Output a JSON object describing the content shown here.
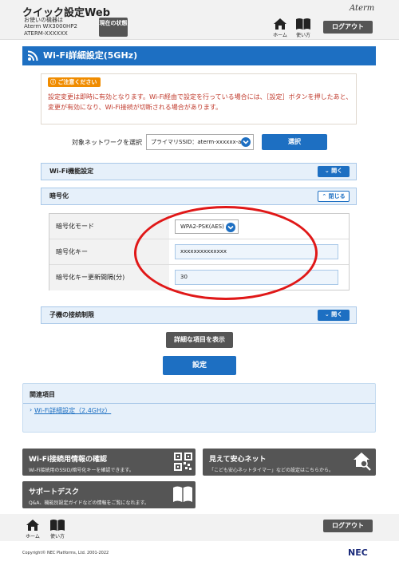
{
  "header": {
    "app_title": "クイック設定Web",
    "device_label": "お使いの機器は",
    "device_model": "Aterm WX3000HP2",
    "device_id": "ATERM-XXXXXX",
    "status_button": "現在の状態",
    "brand": "Aterm",
    "home_label": "ホーム",
    "help_label": "使い方",
    "logout_label": "ログアウト"
  },
  "page": {
    "title": "Wi-Fi詳細設定(5GHz)"
  },
  "caution": {
    "badge": "ご注意ください",
    "text": "設定変更は即時に有効となります。Wi-Fi経由で設定を行っている場合には、［設定］ボタンを押したあと、変更が有効になり、Wi-Fi接続が切断される場合があります。"
  },
  "network": {
    "label": "対象ネットワークを選択",
    "selected": "プライマリSSID：aterm-xxxxxx-a",
    "select_button": "選択"
  },
  "sections": {
    "wifi_function": {
      "label": "Wi-Fi機能設定",
      "toggle": "開く"
    },
    "encryption": {
      "label": "暗号化",
      "toggle": "閉じる"
    },
    "child_restrict": {
      "label": "子機の接続制限",
      "toggle": "開く"
    }
  },
  "encryption": {
    "mode_label": "暗号化モード",
    "mode_value": "WPA2-PSK(AES)",
    "key_label": "暗号化キー",
    "key_value": "xxxxxxxxxxxxxx",
    "interval_label": "暗号化キー更新間隔(分)",
    "interval_value": "30"
  },
  "actions": {
    "details_button": "詳細な項目を表示",
    "apply_button": "設定"
  },
  "related": {
    "heading": "関連項目",
    "link": "Wi-Fi詳細設定（2.4GHz）"
  },
  "cards": {
    "wifi_info": {
      "title": "Wi-Fi接続用情報の確認",
      "desc": "Wi-Fi接続用のSSID/暗号化キーを確認できます。"
    },
    "safety_net": {
      "title": "見えて安心ネット",
      "desc": "「こども安心ネットタイマー」などの設定はこちらから。"
    },
    "support": {
      "title": "サポートデスク",
      "desc": "Q&A、機能別設定ガイドなどの情報をご覧になれます。"
    }
  },
  "footer": {
    "home_label": "ホーム",
    "help_label": "使い方",
    "logout_label": "ログアウト",
    "copyright": "Copyright© NEC Platforms, Ltd. 2001-2022",
    "logo": "NEC"
  },
  "colors": {
    "accent": "#1d6fc2",
    "dark_button": "#555555",
    "caution_text": "#c0392b",
    "highlight_oval": "#e01818"
  },
  "icons": [
    "home-icon",
    "book-icon",
    "wifi-icon",
    "chevron-down-icon",
    "chevron-up-icon",
    "qr-code-icon",
    "house-search-icon"
  ]
}
